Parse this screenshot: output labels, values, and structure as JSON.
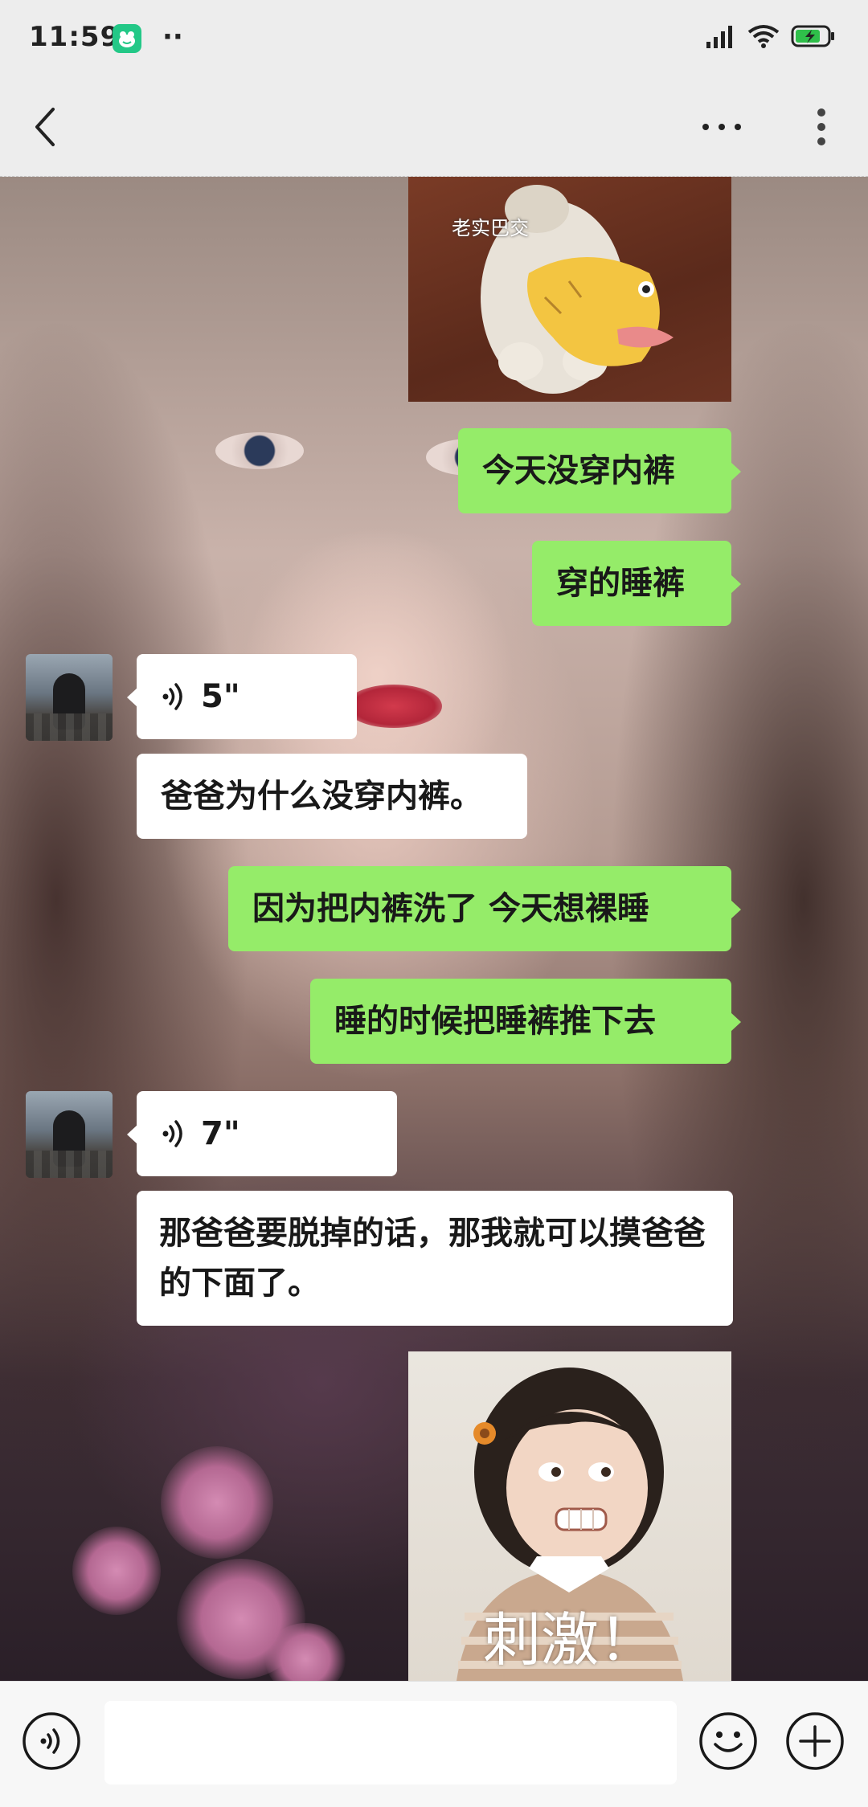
{
  "status_bar": {
    "time": "11:59",
    "app_icon": "frog-notification-icon",
    "overflow_dots": "··",
    "icons": [
      "signal-icon",
      "wifi-icon",
      "battery-charging-icon"
    ]
  },
  "title_bar": {
    "back_icon": "chevron-left-icon",
    "more_icon": "more-horizontal-icon",
    "menu_icon": "more-vertical-icon"
  },
  "messages": [
    {
      "side": "sent",
      "type": "sticker",
      "caption": "老实巴交",
      "icon": "cat-with-banana-sticker"
    },
    {
      "side": "sent",
      "type": "text",
      "text": "今天没穿内裤"
    },
    {
      "side": "sent",
      "type": "text",
      "text": "穿的睡裤"
    },
    {
      "side": "received",
      "type": "voice",
      "duration": "5\"",
      "icon": "voice-wave-icon"
    },
    {
      "side": "received",
      "type": "text",
      "text": "爸爸为什么没穿内裤。"
    },
    {
      "side": "sent",
      "type": "text",
      "text": "因为把内裤洗了 今天想裸睡"
    },
    {
      "side": "sent",
      "type": "text",
      "text": "睡的时候把睡裤推下去"
    },
    {
      "side": "received",
      "type": "voice",
      "duration": "7\"",
      "icon": "voice-wave-icon"
    },
    {
      "side": "received",
      "type": "text",
      "text": "那爸爸要脱掉的话，那我就可以摸爸爸的下面了。"
    },
    {
      "side": "sent",
      "type": "sticker",
      "caption": "刺激！",
      "icon": "little-girl-sticker"
    }
  ],
  "input_bar": {
    "voice_icon": "voice-input-icon",
    "message_value": "",
    "emoji_icon": "emoji-icon",
    "plus_icon": "plus-circle-icon"
  },
  "colors": {
    "sent_bubble": "#95ec69",
    "received_bubble": "#ffffff",
    "bar_background": "#ededed"
  }
}
